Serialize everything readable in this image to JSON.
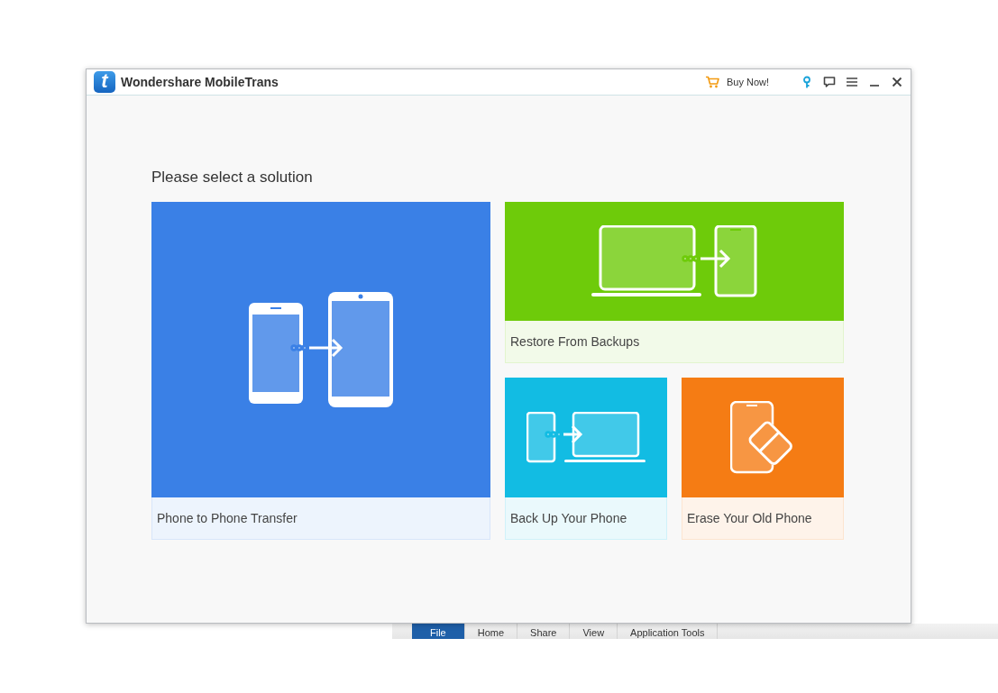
{
  "window": {
    "logo": "t",
    "title": "Wondershare MobileTrans",
    "buy_label": "Buy Now!"
  },
  "heading": "Please select a solution",
  "tiles": [
    {
      "kind": "phone-transfer",
      "label": "Phone to Phone Transfer",
      "color": "#3a80e6"
    },
    {
      "kind": "restore",
      "label": "Restore From Backups",
      "color": "#6ecb0a"
    },
    {
      "kind": "backup",
      "label": "Back Up Your Phone",
      "color": "#12bce3"
    },
    {
      "kind": "erase",
      "label": "Erase Your Old Phone",
      "color": "#f57c14"
    }
  ],
  "ribbon": {
    "tabs": [
      {
        "label": "File",
        "selected": true
      },
      {
        "label": "Home",
        "selected": false
      },
      {
        "label": "Share",
        "selected": false
      },
      {
        "label": "View",
        "selected": false
      },
      {
        "label": "Application Tools",
        "selected": false
      }
    ]
  }
}
